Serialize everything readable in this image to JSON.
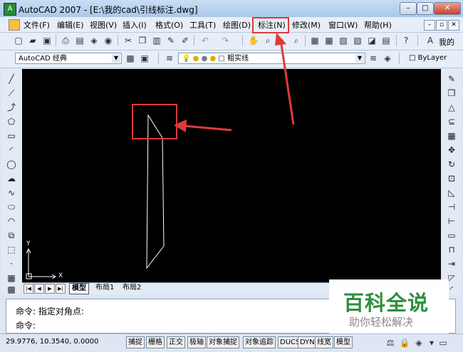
{
  "window": {
    "app_icon": "A",
    "title": "AutoCAD 2007 - [E:\\我的cad\\引线标注.dwg]",
    "min_label": "–",
    "max_label": "□",
    "close_label": "✕"
  },
  "menu": {
    "file": "文件(F)",
    "edit": "编辑(E)",
    "view": "视图(V)",
    "insert": "插入(I)",
    "format": "格式(O)",
    "tools": "工具(T)",
    "draw": "绘图(D)",
    "dimension": "标注(N)",
    "modify": "修改(M)",
    "window": "窗口(W)",
    "help": "帮助(H)",
    "doc_min": "–",
    "doc_max": "▫",
    "doc_close": "✕",
    "extra": "我的"
  },
  "toolbar2": {
    "workspace": "AutoCAD 经典",
    "layer": "粗实线",
    "color": "ByLayer"
  },
  "layout_tabs": {
    "model": "模型",
    "layout1": "布局1",
    "layout2": "布局2"
  },
  "ucs": {
    "y_label": "Y",
    "x_label": "X"
  },
  "command": {
    "line1": "命令: 指定对角点:",
    "line2": "命令:"
  },
  "status": {
    "coords": "29.9776, 10.3540, 0.0000",
    "snap": "捕捉",
    "grid": "栅格",
    "ortho": "正交",
    "polar": "极轴",
    "osnap": "对象捕捉",
    "otrack": "对象追踪",
    "ducs": "DUCS",
    "dyn": "DYN",
    "lwt": "线宽",
    "model": "模型"
  },
  "watermark": {
    "title": "百科全说",
    "subtitle": "助你轻松解决"
  },
  "colors": {
    "annotation_red": "#e0393b",
    "canvas_bg": "#000000",
    "drawing_line": "#ffffff",
    "watermark_green": "#2e8f3e"
  }
}
